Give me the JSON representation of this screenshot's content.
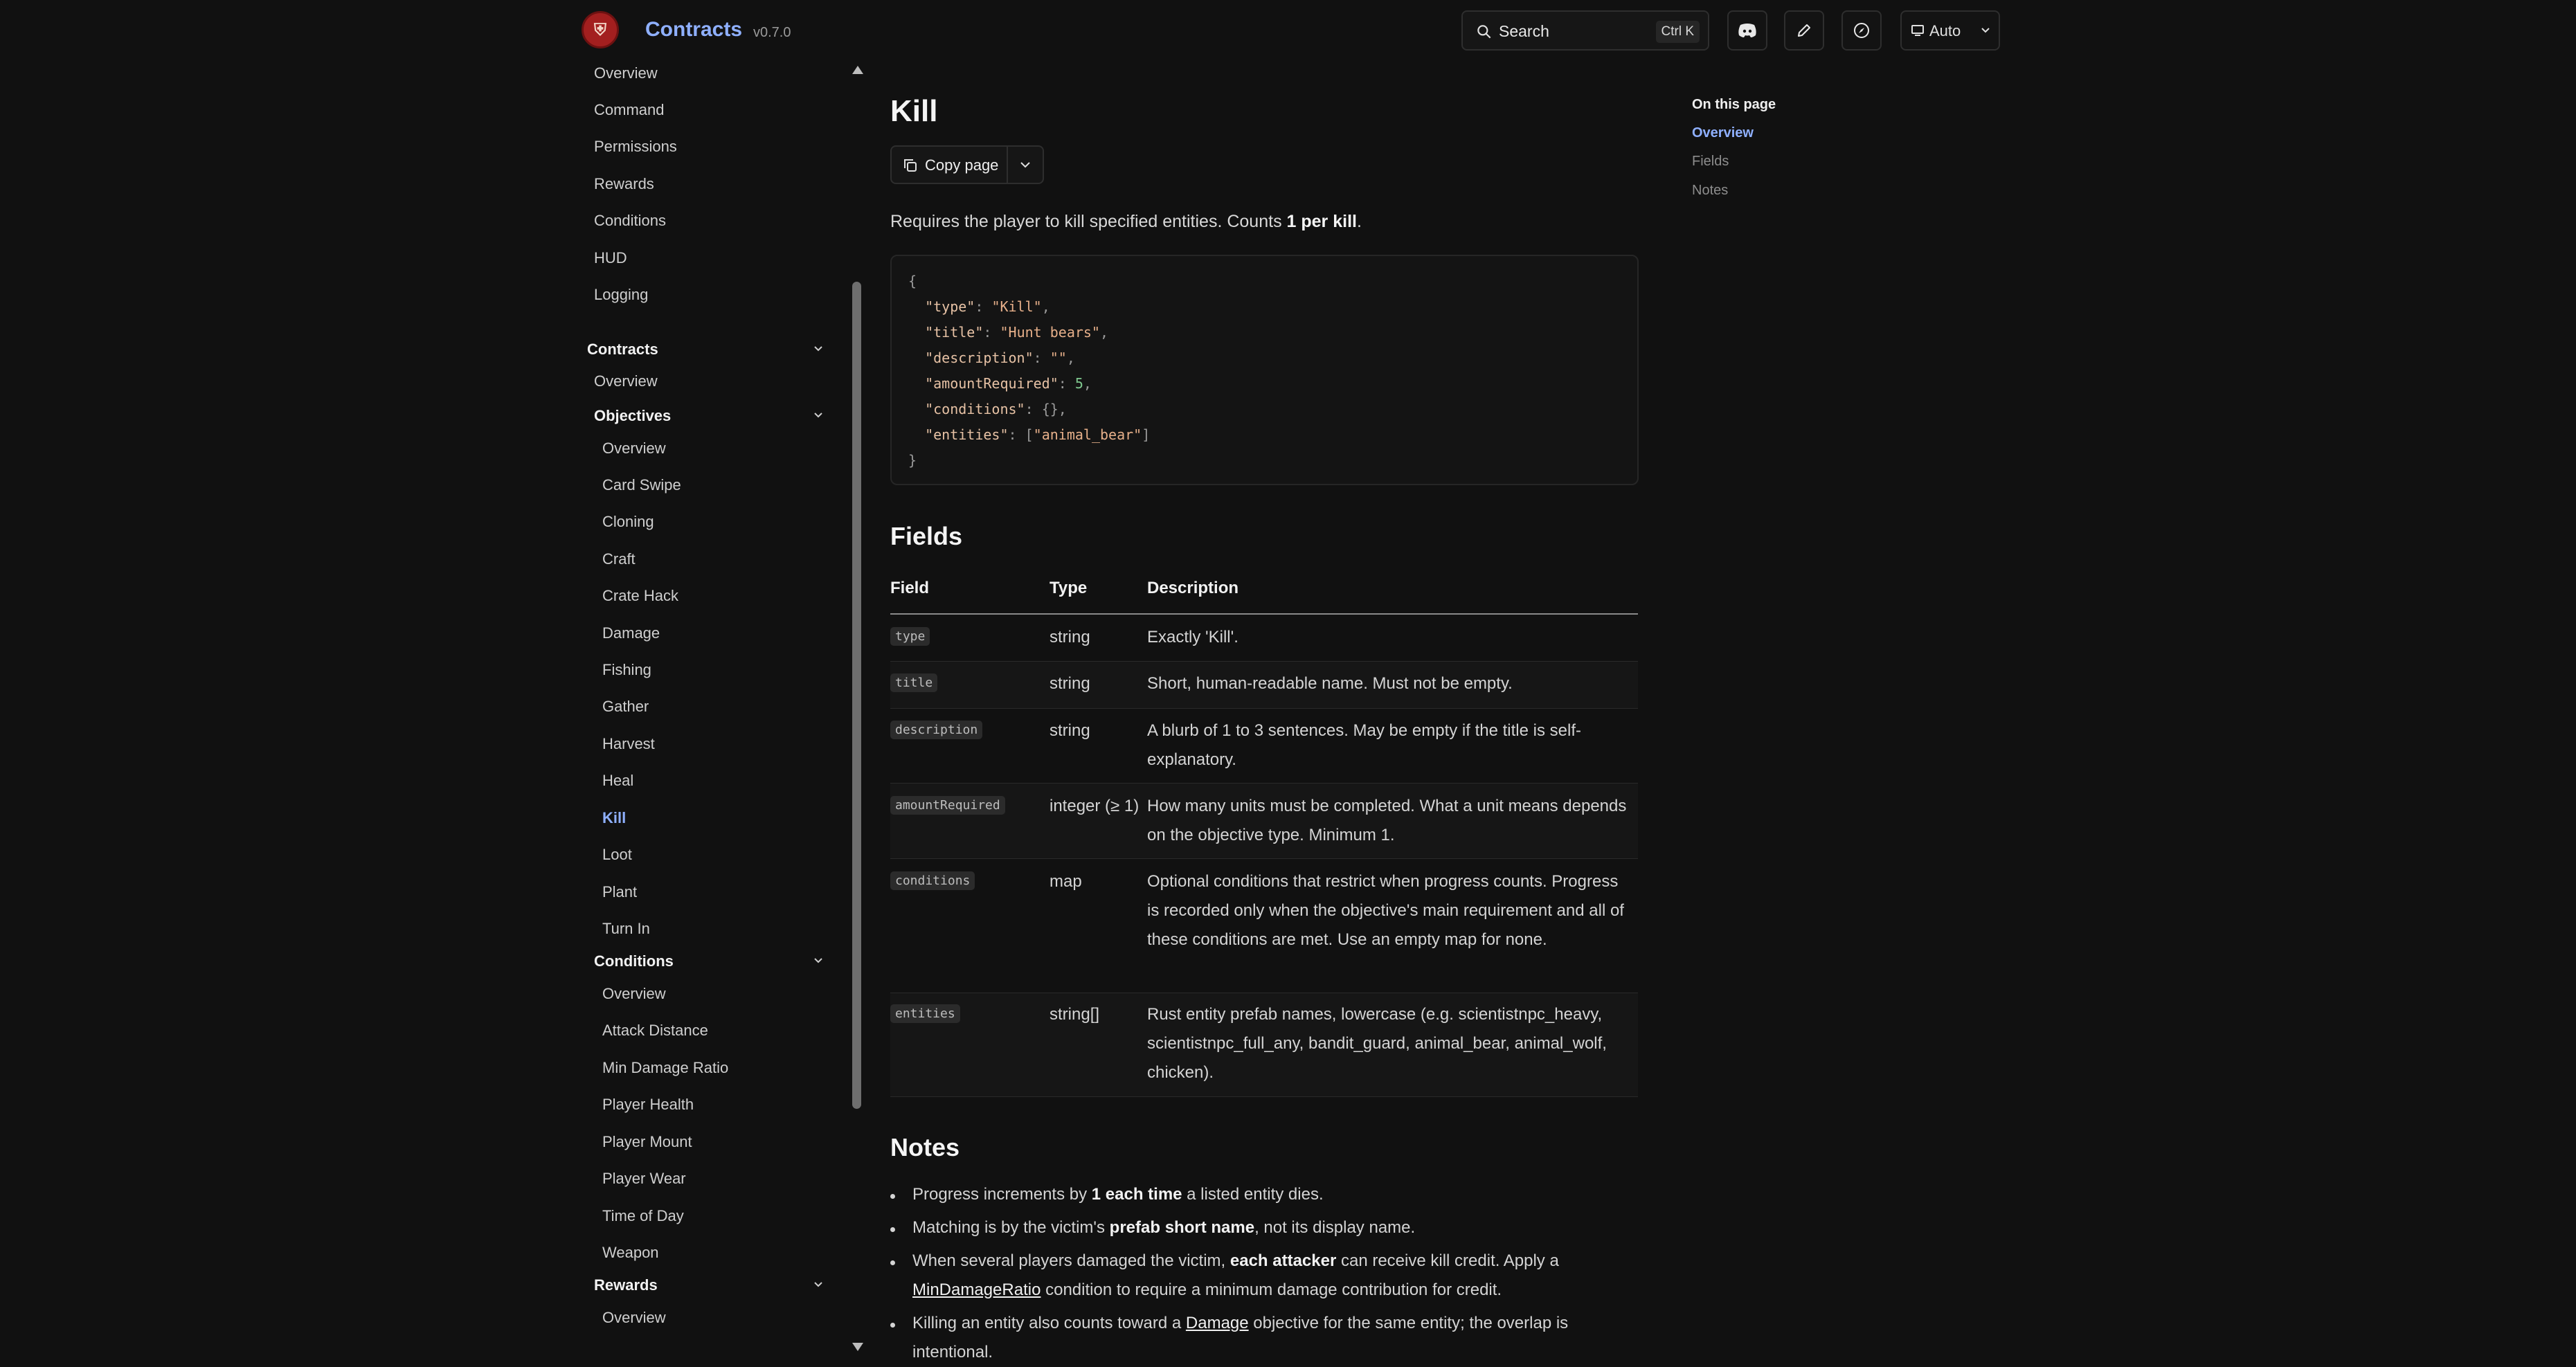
{
  "header": {
    "brand": "Contracts",
    "version": "v0.7.0",
    "search_label": "Search",
    "search_shortcut": "Ctrl K",
    "theme_label": "Auto",
    "accent_color": "#8fb0ff"
  },
  "sidebar": {
    "top_items": [
      "Overview",
      "Command",
      "Permissions",
      "Rewards",
      "Conditions",
      "HUD",
      "Logging"
    ],
    "contracts_section": "Contracts",
    "contracts_overview": "Overview",
    "objectives_section": "Objectives",
    "objectives_items": [
      "Overview",
      "Card Swipe",
      "Cloning",
      "Craft",
      "Crate Hack",
      "Damage",
      "Fishing",
      "Gather",
      "Harvest",
      "Heal",
      "Kill",
      "Loot",
      "Plant",
      "Turn In"
    ],
    "active_item": "Kill",
    "conditions_section": "Conditions",
    "conditions_items": [
      "Overview",
      "Attack Distance",
      "Min Damage Ratio",
      "Player Health",
      "Player Mount",
      "Player Wear",
      "Time of Day",
      "Weapon"
    ],
    "rewards_section": "Rewards",
    "rewards_items": [
      "Overview"
    ]
  },
  "page": {
    "title": "Kill",
    "copy_label": "Copy page",
    "intro_prefix": "Requires the player to kill specified entities. Counts ",
    "intro_bold": "1 per kill",
    "intro_suffix": "."
  },
  "code_example": {
    "open": "{",
    "close": "}",
    "lines": [
      {
        "key": "\"type\"",
        "value": "\"Kill\"",
        "kind": "string"
      },
      {
        "key": "\"title\"",
        "value": "\"Hunt bears\"",
        "kind": "string"
      },
      {
        "key": "\"description\"",
        "value": "\"\"",
        "kind": "string"
      },
      {
        "key": "\"amountRequired\"",
        "value": "5",
        "kind": "number"
      },
      {
        "key": "\"conditions\"",
        "value": "{}",
        "kind": "punct"
      },
      {
        "key": "\"entities\"",
        "value_pre": "[",
        "value": "\"animal_bear\"",
        "value_post": "]",
        "kind": "array"
      }
    ]
  },
  "fields": {
    "heading": "Fields",
    "columns": [
      "Field",
      "Type",
      "Description"
    ],
    "rows": [
      {
        "field": "type",
        "type": "string",
        "description": "Exactly 'Kill'."
      },
      {
        "field": "title",
        "type": "string",
        "description": "Short, human-readable name. Must not be empty."
      },
      {
        "field": "description",
        "type": "string",
        "description": "A blurb of 1 to 3 sentences. May be empty if the title is self-explanatory."
      },
      {
        "field": "amountRequired",
        "type": "integer (≥ 1)",
        "description": "How many units must be completed. What a unit means depends on the objective type. Minimum 1."
      },
      {
        "field": "conditions",
        "type": "map",
        "description": "Optional conditions that restrict when progress counts. Progress is recorded only when the objective's main requirement and all of these conditions are met. Use an empty map for none."
      },
      {
        "field": "entities",
        "type": "string[]",
        "description": "Rust entity prefab names, lowercase (e.g. scientistnpc_heavy, scientistnpc_full_any, bandit_guard, animal_bear, animal_wolf, chicken)."
      }
    ]
  },
  "notes": {
    "heading": "Notes",
    "n1_a": "Progress increments by ",
    "n1_b": "1 each time",
    "n1_c": " a listed entity dies.",
    "n2_a": "Matching is by the victim's ",
    "n2_b": "prefab short name",
    "n2_c": ", not its display name.",
    "n3_a": "When several players damaged the victim, ",
    "n3_b": "each attacker",
    "n3_c": " can receive kill credit. Apply a ",
    "n3_link": "MinDamageRatio",
    "n3_d": " condition to require a minimum damage contribution for credit.",
    "n4_a": "Killing an entity also counts toward a ",
    "n4_link": "Damage",
    "n4_b": " objective for the same entity; the overlap is intentional."
  },
  "toc": {
    "title": "On this page",
    "items": [
      "Overview",
      "Fields",
      "Notes"
    ],
    "active": "Overview"
  }
}
